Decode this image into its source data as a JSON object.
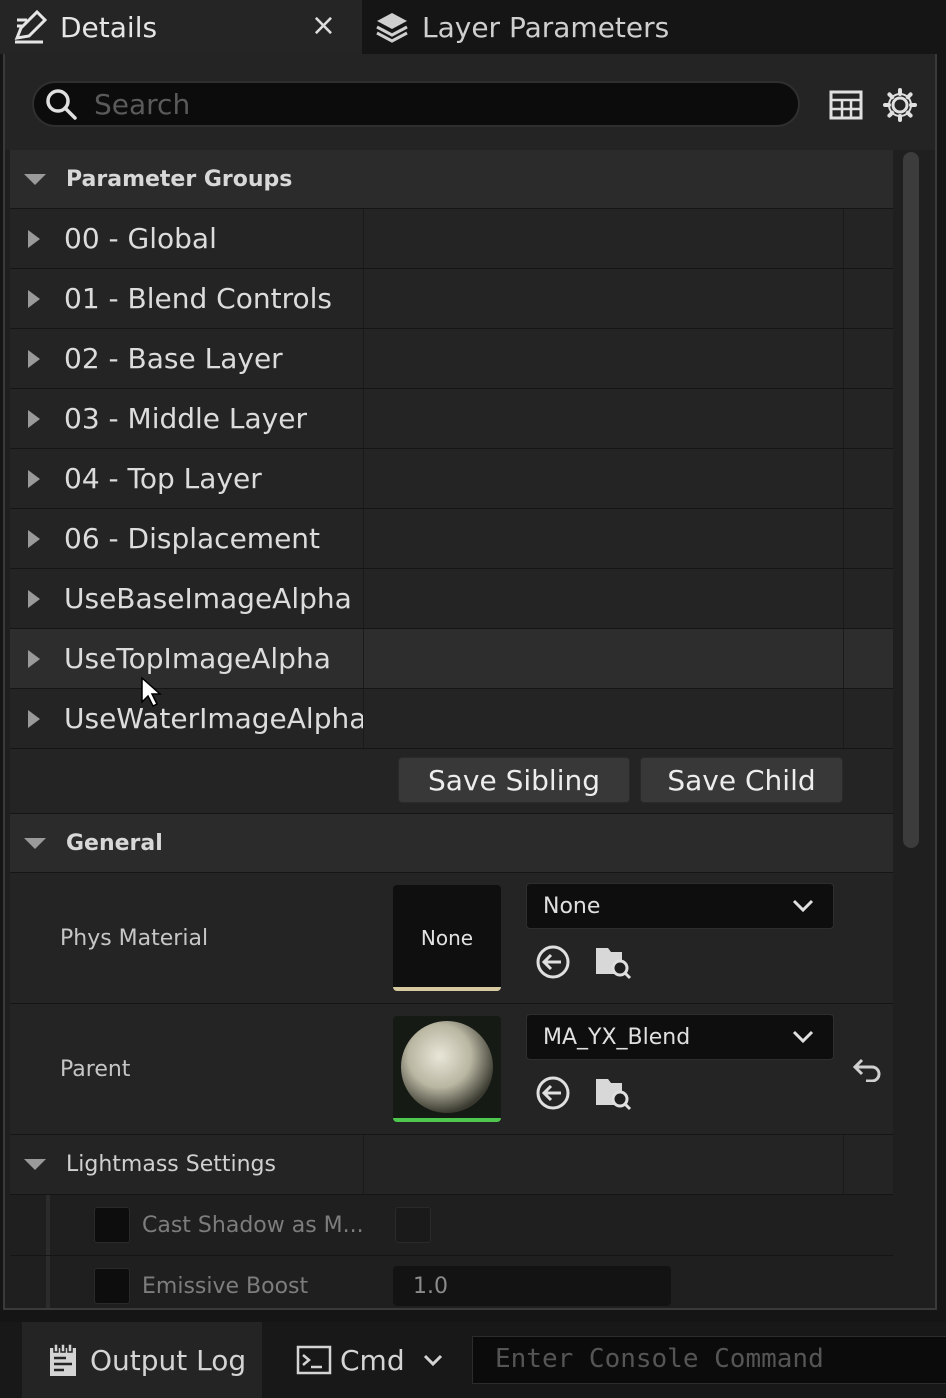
{
  "tabs": {
    "details_label": "Details",
    "details_close": "×",
    "layer_label": "Layer Parameters"
  },
  "search": {
    "placeholder": "Search"
  },
  "sections": {
    "parameter_groups": "Parameter Groups",
    "general": "General",
    "lightmass": "Lightmass Settings"
  },
  "groups": [
    "00 - Global",
    "01 - Blend Controls",
    "02 - Base Layer",
    "03 - Middle Layer",
    "04 - Top Layer",
    "06 - Displacement",
    "UseBaseImageAlpha",
    "UseTopImageAlpha",
    "UseWaterImageAlpha"
  ],
  "buttons": {
    "save_sibling": "Save Sibling",
    "save_child": "Save Child"
  },
  "phys_material": {
    "label": "Phys Material",
    "thumb_text": "None",
    "value": "None"
  },
  "parent": {
    "label": "Parent",
    "value": "MA_YX_Blend"
  },
  "lightmass": {
    "cast_shadow": "Cast Shadow as M...",
    "emissive_boost": "Emissive Boost",
    "emissive_value": "1.0"
  },
  "bottom": {
    "output_log": "Output Log",
    "cmd": "Cmd",
    "console_placeholder": "Enter Console Command"
  },
  "colors": {
    "phys_thumb_bar": "#d6c9a0",
    "parent_thumb_bar": "#4fc84f"
  }
}
